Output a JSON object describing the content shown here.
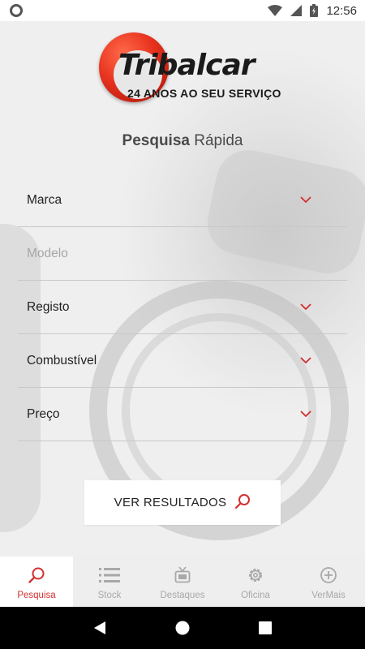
{
  "status_bar": {
    "time": "12:56"
  },
  "logo": {
    "name": "Tribalcar",
    "tagline": "24 ANOS AO SEU SERVIÇO"
  },
  "page_title": {
    "bold": "Pesquisa",
    "regular": " Rápida"
  },
  "form": {
    "fields": [
      {
        "label": "Marca",
        "placeholder": false,
        "has_dropdown": true
      },
      {
        "label": "Modelo",
        "placeholder": true,
        "has_dropdown": false
      },
      {
        "label": "Registo",
        "placeholder": false,
        "has_dropdown": true
      },
      {
        "label": "Combustível",
        "placeholder": false,
        "has_dropdown": true
      },
      {
        "label": "Preço",
        "placeholder": false,
        "has_dropdown": true
      }
    ],
    "submit_label": "VER RESULTADOS"
  },
  "bottom_nav": {
    "items": [
      {
        "label": "Pesquisa",
        "icon": "search-icon",
        "active": true
      },
      {
        "label": "Stock",
        "icon": "list-icon",
        "active": false
      },
      {
        "label": "Destaques",
        "icon": "tv-icon",
        "active": false
      },
      {
        "label": "Oficina",
        "icon": "gear-icon",
        "active": false
      },
      {
        "label": "VerMais",
        "icon": "plus-circle-icon",
        "active": false
      }
    ]
  },
  "colors": {
    "accent": "#d32f2f",
    "logo_red": "#e8321e",
    "nav_inactive": "#a8a8a8"
  }
}
